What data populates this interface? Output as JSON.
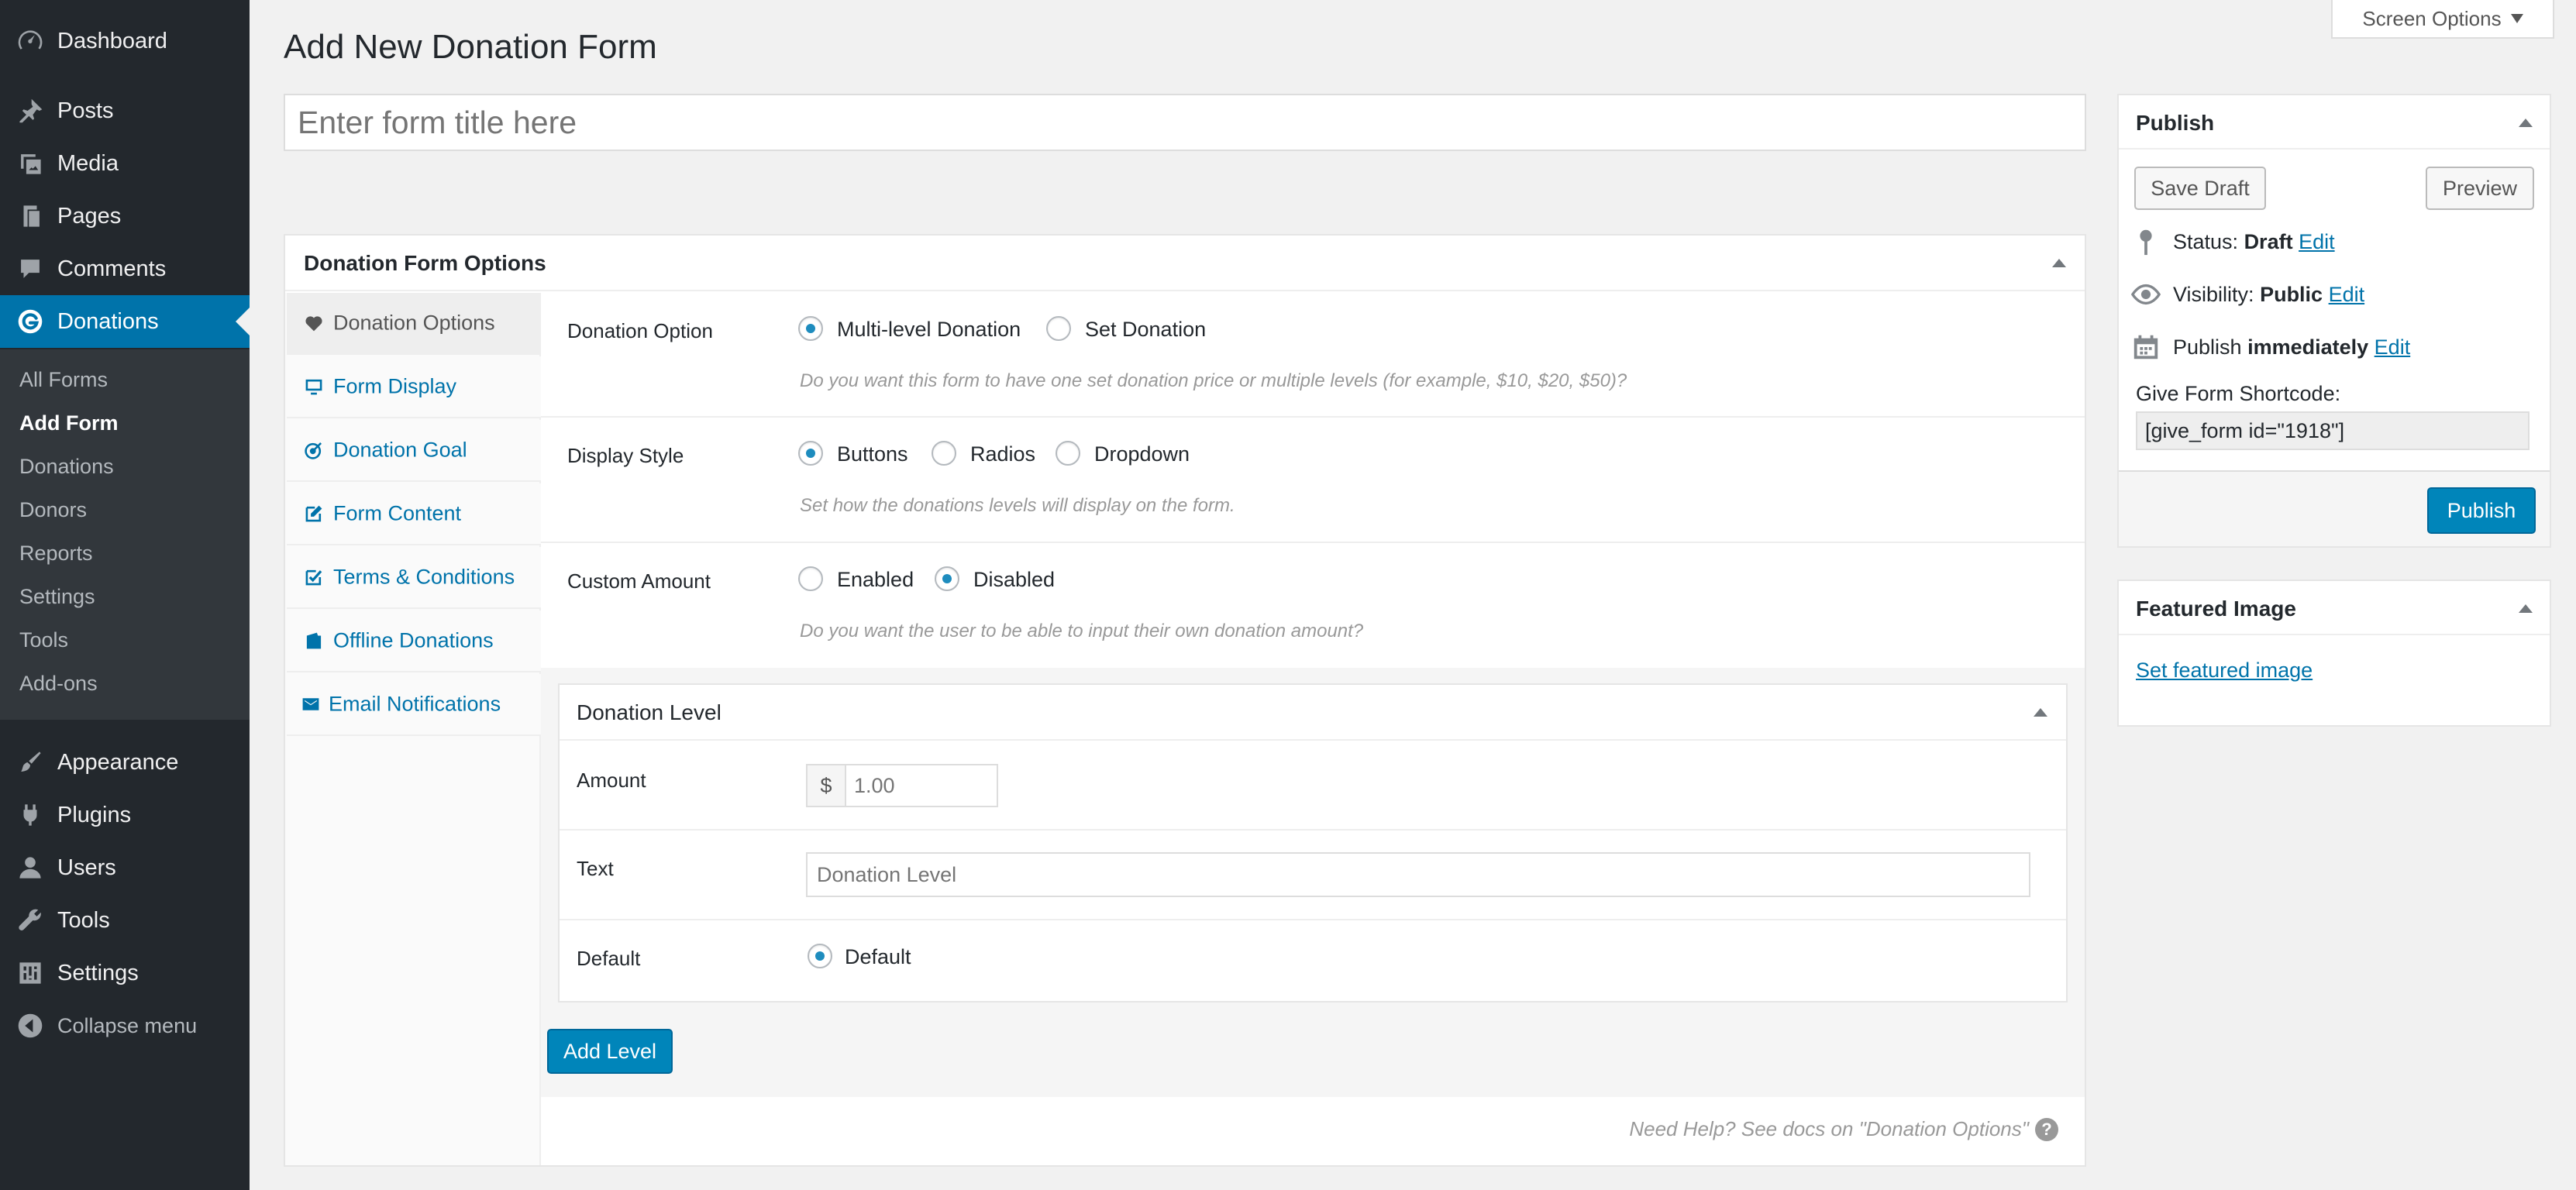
{
  "sidebar": {
    "items": [
      {
        "label": "Dashboard",
        "icon": "dashboard-icon"
      },
      {
        "label": "Posts",
        "icon": "pin-icon"
      },
      {
        "label": "Media",
        "icon": "media-icon"
      },
      {
        "label": "Pages",
        "icon": "pages-icon"
      },
      {
        "label": "Comments",
        "icon": "comments-icon"
      },
      {
        "label": "Donations",
        "icon": "give-icon"
      }
    ],
    "submenu": [
      "All Forms",
      "Add Form",
      "Donations",
      "Donors",
      "Reports",
      "Settings",
      "Tools",
      "Add-ons"
    ],
    "lower_items": [
      {
        "label": "Appearance",
        "icon": "brush-icon"
      },
      {
        "label": "Plugins",
        "icon": "plugin-icon"
      },
      {
        "label": "Users",
        "icon": "users-icon"
      },
      {
        "label": "Tools",
        "icon": "wrench-icon"
      },
      {
        "label": "Settings",
        "icon": "settings-icon"
      },
      {
        "label": "Collapse menu",
        "icon": "collapse-icon"
      }
    ]
  },
  "screen_options": "Screen Options",
  "page_title": "Add New Donation Form",
  "title_input": {
    "placeholder": "Enter form title here",
    "value": ""
  },
  "options_box": {
    "title": "Donation Form Options",
    "tabs": [
      "Donation Options",
      "Form Display",
      "Donation Goal",
      "Form Content",
      "Terms & Conditions",
      "Offline Donations",
      "Email Notifications"
    ],
    "donation_option": {
      "label": "Donation Option",
      "options": [
        "Multi-level Donation",
        "Set Donation"
      ],
      "selected": "Multi-level Donation",
      "description": "Do you want this form to have one set donation price or multiple levels (for example, $10, $20, $50)?"
    },
    "display_style": {
      "label": "Display Style",
      "options": [
        "Buttons",
        "Radios",
        "Dropdown"
      ],
      "selected": "Buttons",
      "description": "Set how the donations levels will display on the form."
    },
    "custom_amount": {
      "label": "Custom Amount",
      "options": [
        "Enabled",
        "Disabled"
      ],
      "selected": "Disabled",
      "description": "Do you want the user to be able to input their own donation amount?"
    },
    "level": {
      "title": "Donation Level",
      "amount_label": "Amount",
      "currency": "$",
      "amount_placeholder": "1.00",
      "text_label": "Text",
      "text_placeholder": "Donation Level",
      "default_label": "Default",
      "default_option": "Default"
    },
    "add_level": "Add Level",
    "help_text": "Need Help? See docs on \"Donation Options\""
  },
  "publish": {
    "title": "Publish",
    "save_draft": "Save Draft",
    "preview": "Preview",
    "status_label": "Status:",
    "status_value": "Draft",
    "visibility_label": "Visibility:",
    "visibility_value": "Public",
    "publish_label": "Publish",
    "publish_value": "immediately",
    "edit": "Edit",
    "shortcode_label": "Give Form Shortcode:",
    "shortcode_value": "[give_form id=\"1918\"]",
    "publish_button": "Publish"
  },
  "featured": {
    "title": "Featured Image",
    "link": "Set featured image"
  },
  "colors": {
    "accent": "#0073aa",
    "primary_button": "#0085ba",
    "sidebar": "#23282d"
  }
}
